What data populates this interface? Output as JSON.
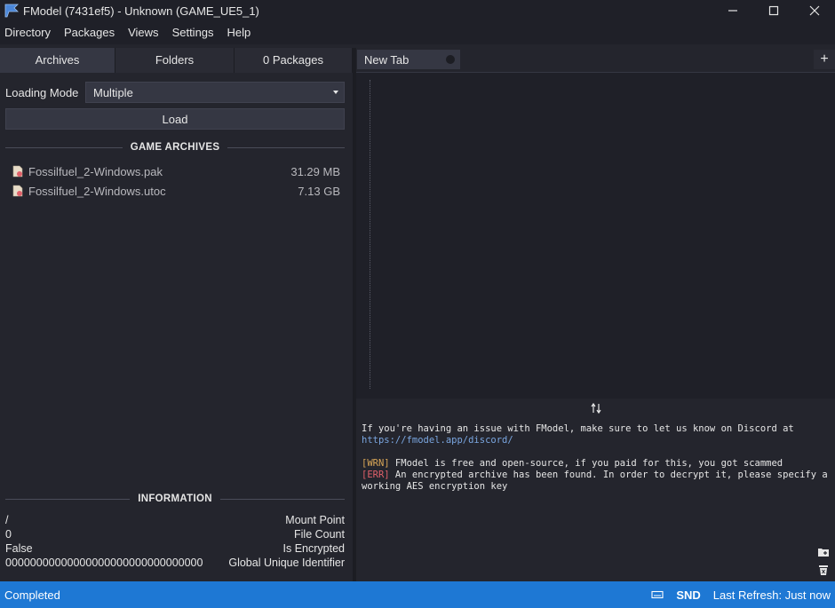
{
  "window": {
    "title": "FModel (7431ef5) - Unknown (GAME_UE5_1)",
    "icons": [
      "app-icon",
      "minimize-icon",
      "maximize-icon",
      "close-icon"
    ]
  },
  "menu": {
    "items": [
      "Directory",
      "Packages",
      "Views",
      "Settings",
      "Help"
    ]
  },
  "left": {
    "tabs": [
      "Archives",
      "Folders",
      "0 Packages"
    ],
    "active_tab": "Archives",
    "loading_mode_label": "Loading Mode",
    "loading_mode_value": "Multiple",
    "load_button": "Load",
    "archives_header": "GAME ARCHIVES",
    "archives": [
      {
        "name": "Fossilfuel_2-Windows.pak",
        "size": "31.29 MB"
      },
      {
        "name": "Fossilfuel_2-Windows.utoc",
        "size": "7.13 GB"
      }
    ],
    "info_header": "INFORMATION",
    "info": [
      {
        "value": "/",
        "label": "Mount Point"
      },
      {
        "value": "0",
        "label": "File Count"
      },
      {
        "value": "False",
        "label": "Is Encrypted"
      },
      {
        "value": "00000000000000000000000000000000",
        "label": "Global Unique Identifier"
      }
    ]
  },
  "right": {
    "doc_tab": "New Tab",
    "add_tab": "+",
    "console": {
      "line1_prefix": "If you're having an issue with FModel, make sure to let us know on Discord at ",
      "line1_link": "https://fmodel.app/discord/",
      "wrn_tag": "[WRN]",
      "wrn_text": " FModel is free and open-source, if you paid for this, you got scammed",
      "err_tag": "[ERR]",
      "err_text": " An encrypted archive has been found. In order to decrypt it, please specify a working AES encryption key"
    }
  },
  "status": {
    "left": "Completed",
    "snd": "SND",
    "last_refresh": "Last Refresh: Just now"
  },
  "colors": {
    "accent": "#1e78d4",
    "background": "#24252d",
    "link": "#7aa6e0",
    "warning": "#d8a657",
    "error": "#e0606a"
  }
}
